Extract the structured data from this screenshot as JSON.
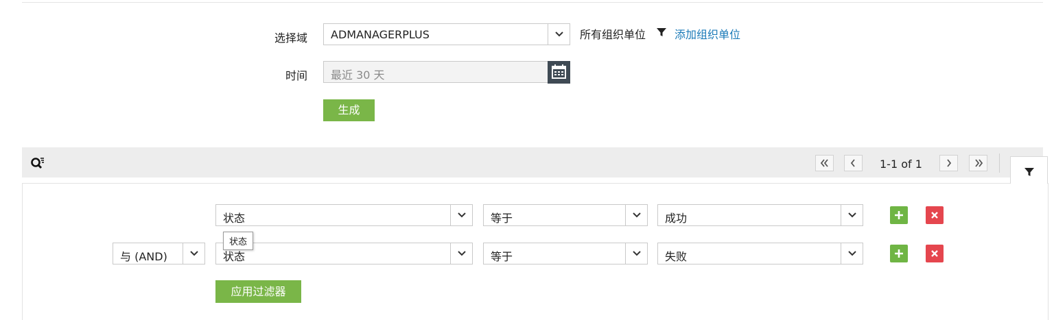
{
  "form": {
    "domain_label": "选择域",
    "domain_value": "ADMANAGERPLUS",
    "all_ou_label": "所有组织单位",
    "add_ou_link": "添加组织单位",
    "time_label": "时间",
    "time_value": "最近 30 天",
    "generate_button": "生成"
  },
  "pagination": {
    "range_text": "1-1 of 1"
  },
  "filters": {
    "rows": [
      {
        "field": "状态",
        "operator": "等于",
        "value": "成功"
      },
      {
        "connector": "与 (AND)",
        "field": "状态",
        "operator": "等于",
        "value": "失败"
      }
    ],
    "tooltip_text": "状态",
    "apply_button": "应用过滤器"
  },
  "colors": {
    "green": "#7ab648",
    "red": "#e5464e",
    "link": "#1a7ab8",
    "dark": "#3f4a54"
  }
}
